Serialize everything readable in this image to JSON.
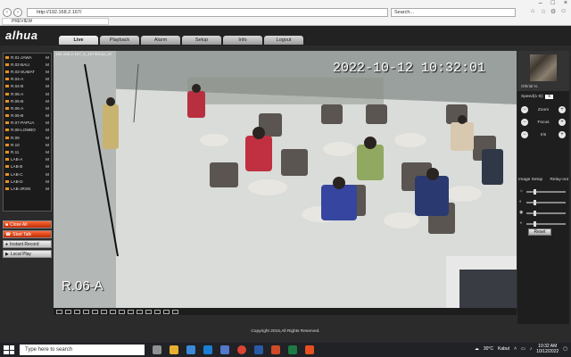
{
  "browser": {
    "url": "http://192.168.2.167/",
    "search_placeholder": "Search...",
    "tab_title": "PREVIEW"
  },
  "app": {
    "logo": "alhua",
    "menu": [
      {
        "label": "Live",
        "active": true
      },
      {
        "label": "Playback",
        "active": false
      },
      {
        "label": "Alarm",
        "active": false
      },
      {
        "label": "Setup",
        "active": false
      },
      {
        "label": "Info",
        "active": false
      },
      {
        "label": "Logout",
        "active": false
      }
    ],
    "channels": [
      "R.01-JAWA",
      "R.02-BALI",
      "R.03-SUMAT",
      "R.04-A",
      "R.04-B",
      "R.05-A",
      "R.05-B",
      "R.06-A",
      "R.06-B",
      "R.07-PAPUA",
      "R.08-LOMBO",
      "R.09",
      "R.10",
      "R.11",
      "LAB-A",
      "LAB-B",
      "LAB-C",
      "LAB-D",
      "LAB-JRSN"
    ],
    "channel_flag": "M",
    "actions": [
      "Close All",
      "Start Talk",
      "Instant Record",
      "Local Play"
    ],
    "video": {
      "info": "192.168.2.167_8_1873Kbps_M",
      "timestamp": "2022-10-12 10:32:01",
      "camera_name": "R.06-A"
    },
    "ptz": {
      "thumb_label": "Othrial N.",
      "speed_label": "Speed(1-8):",
      "speed_value": "5",
      "zoom": "Zoom",
      "focus": "Focus",
      "iris": "Iris",
      "image_setup": "Image Setup",
      "relay_out": "Relay-out",
      "reset": "Reset"
    },
    "copyright": "Copyright 2015,All Rights Reserved."
  },
  "taskbar": {
    "search_placeholder": "Type here to search",
    "temperature": "30°C",
    "weather": "Kabut",
    "time": "10:32 AM",
    "date": "10/12/2022"
  }
}
